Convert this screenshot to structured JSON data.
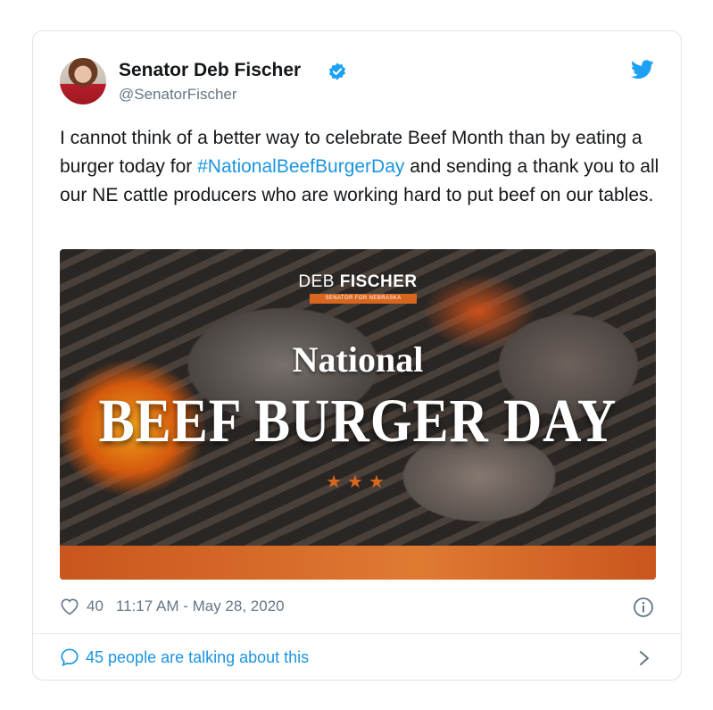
{
  "tweet": {
    "author_name": "Senator Deb Fischer",
    "handle": "@SenatorFischer",
    "text_before": "I cannot think of a better way to celebrate Beef Month than by eating a burger today for ",
    "hashtag": "#NationalBeefBurgerDay",
    "text_after": " and sending a thank you to all our NE cattle producers who are working hard to put beef on our tables.",
    "like_count": "40",
    "timestamp": "11:17 AM - May 28, 2020",
    "talking": "45 people are talking about this"
  },
  "media": {
    "brand_first": "DEB ",
    "brand_last": "FISCHER",
    "brand_sub": "SENATOR FOR NEBRASKA",
    "headline_top": "National",
    "headline_main": "BEEF BURGER DAY",
    "stars": "★★★"
  },
  "colors": {
    "link": "#1b95e0",
    "verified": "#1da1f2",
    "muted": "#657786",
    "accent_orange": "#d9661f"
  },
  "icons": {
    "verified": "verified-badge-icon",
    "bird": "twitter-bird-icon",
    "like": "heart-icon",
    "info": "info-icon",
    "reply": "speech-bubble-icon",
    "chevron": "chevron-right-icon"
  }
}
